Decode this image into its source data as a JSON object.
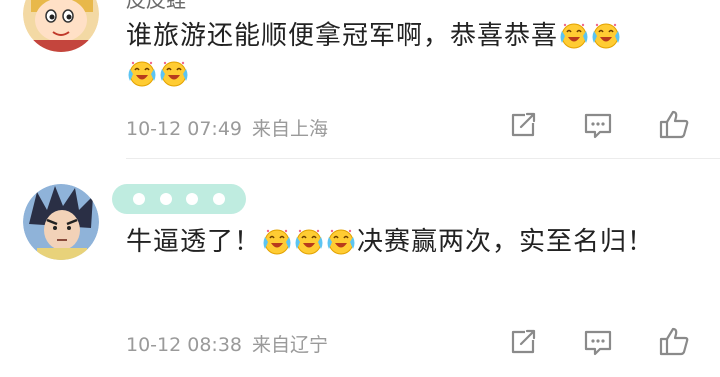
{
  "comments": [
    {
      "username": "皮皮蛙",
      "text_parts": [
        "谁旅游还能顺便拿冠军啊，恭喜恭喜"
      ],
      "emoji_name": "crying-laugh-emoji",
      "date": "10-12 07:49",
      "location": "来自上海",
      "avatar_icon": "crayon-shin-chan-avatar"
    },
    {
      "username_badge": "blurred-username-badge",
      "text_part1": "牛逼透了！",
      "text_part2": "决赛赢两次，实至名归！",
      "emoji_name": "crying-laugh-emoji",
      "date": "10-12 08:38",
      "location": "来自辽宁",
      "avatar_icon": "anime-boy-avatar"
    }
  ],
  "actions": [
    "share-icon",
    "comment-icon",
    "like-icon"
  ],
  "colors": {
    "text": "#222222",
    "meta": "#9a9a9a",
    "icon": "#8a8a8a",
    "badge": "#bfece0",
    "emoji_face": "#ffcc33"
  }
}
